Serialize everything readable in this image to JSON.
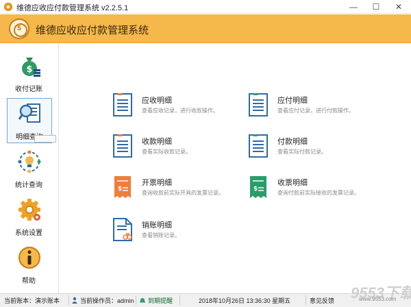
{
  "window": {
    "title": "维德应收应付款管理系统   v2.2.5.1",
    "minimize_glyph": "—",
    "maximize_glyph": "☐",
    "close_glyph": "✕"
  },
  "header": {
    "title": "维德应收应付款管理系统",
    "logo_glyph": "$"
  },
  "sidebar": {
    "items": [
      {
        "label": "收付记账",
        "icon": "money-bag-icon"
      },
      {
        "label": "明细查询",
        "icon": "magnifier-document-icon"
      },
      {
        "label": "统计查询",
        "icon": "lightbulb-chart-icon"
      },
      {
        "label": "系统设置",
        "icon": "gear-icon"
      },
      {
        "label": "帮助",
        "icon": "info-icon"
      }
    ]
  },
  "main": {
    "cards": [
      {
        "title": "应收明细",
        "desc": "查看应收记录，进行收款操作。",
        "icon": "document-list-icon"
      },
      {
        "title": "应付明细",
        "desc": "查看应付记录，进行付款操作。",
        "icon": "document-list-icon"
      },
      {
        "title": "收款明细",
        "desc": "查看实际收款记录。",
        "icon": "document-list-icon"
      },
      {
        "title": "付款明细",
        "desc": "查看实际付款记录。",
        "icon": "document-list-icon"
      },
      {
        "title": "开票明细",
        "desc": "查询收款前实际开具的发票记录。",
        "icon": "invoice-orange-icon"
      },
      {
        "title": "收票明细",
        "desc": "查询付款前实际接收的发票记录。",
        "icon": "invoice-green-icon"
      },
      {
        "title": "销账明细",
        "desc": "查看销账记录。",
        "icon": "writeoff-document-icon"
      }
    ]
  },
  "statusbar": {
    "account": "当前账本：演示账本",
    "operator": "当前操作员：admin",
    "reminder": "到期提醒",
    "datetime": "2018年10月26日  13:36:30  星期五",
    "feedback": "意见反馈"
  },
  "watermark": {
    "text": "9553下载",
    "url": "www.9553.com"
  },
  "colors": {
    "header_bg": "#f5b84a",
    "active_border": "#6fa6d8",
    "doc_blue": "#2f6aa3",
    "invoice_orange": "#ef7d3c",
    "invoice_green": "#2a9d6a"
  }
}
